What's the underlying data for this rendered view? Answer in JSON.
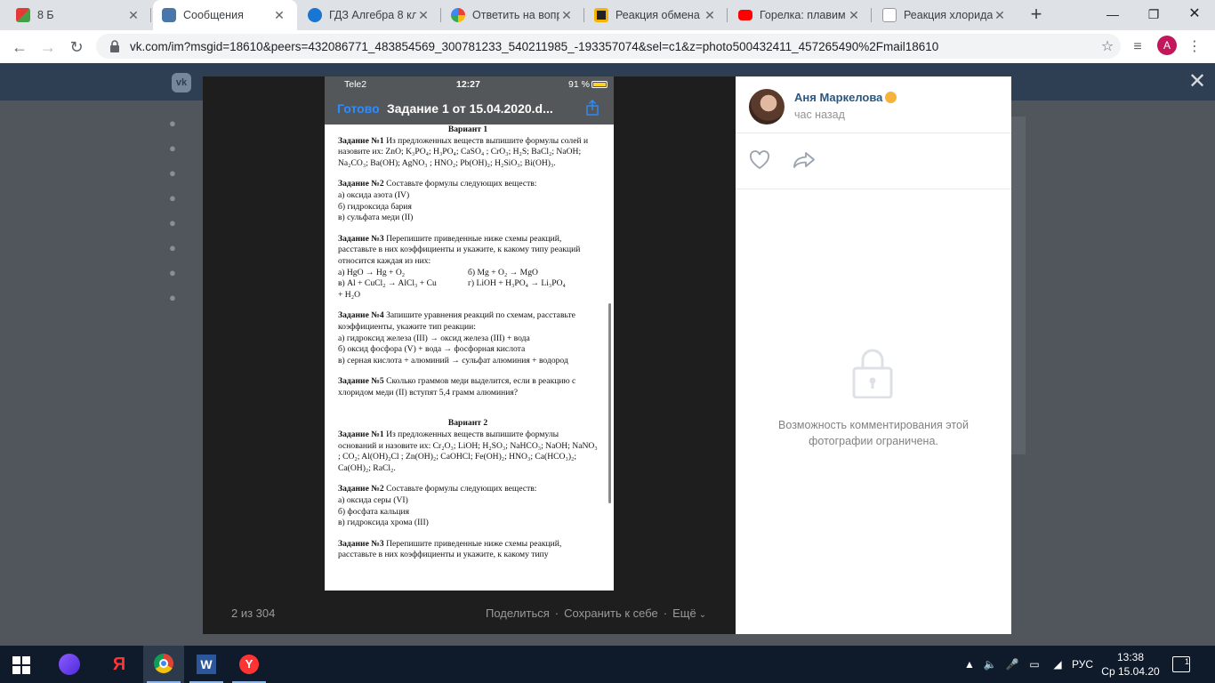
{
  "tabs": [
    {
      "title": "8 Б",
      "icon": "vk-colorful-icon"
    },
    {
      "title": "Сообщения",
      "icon": "vk-messages-icon"
    },
    {
      "title": "ГДЗ Алгебра 8 кл",
      "icon": "gdz-icon"
    },
    {
      "title": "Ответить на вопр",
      "icon": "google-icon"
    },
    {
      "title": "Реакция обмена",
      "icon": "o-icon"
    },
    {
      "title": "Горелка: плавим",
      "icon": "youtube-icon"
    },
    {
      "title": "Реакция хлорида",
      "icon": "doc-icon"
    }
  ],
  "address": {
    "url": "vk.com/im?msgid=18610&peers=432086771_483854569_300781233_540211985_-193357074&sel=c1&z=photo500432411_457265490%2Fmail18610"
  },
  "profile_initial": "A",
  "phone": {
    "carrier": "Tele2",
    "time": "12:27",
    "battery": "91 %",
    "done": "Готово",
    "doc_title": "Задание 1 от 15.04.2020.d..."
  },
  "doc": {
    "v1_head": "Вариант 1",
    "v1_t1_b": "Задание №1",
    "v1_t1": " Из предложенных веществ выпишите формулы солей и назовите их: ZnO; K₃PO₄; H₃PO₄; CaSO₄ ; CrO₃; H₂S; BaCl₂; NaOH; Na₂CO₃; Ba(OH); AgNO₃ ; HNO₂; Pb(OH)₂; H₂SiO₃; Bi(OH)₃.",
    "v1_t2_b": "Задание №2",
    "v1_t2": " Составьте формулы следующих веществ:",
    "v1_t2_a": "а) оксида азота (IV)",
    "v1_t2_bb": "б) гидроксида бария",
    "v1_t2_c": "в) сульфата меди (II)",
    "v1_t3_b": "Задание №3",
    "v1_t3": "  Перепишите приведенные ниже схемы реакций, расставьте в них коэффициенты и укажите, к какому типу реакций относится каждая из них:",
    "v1_t3_r1a": "а)  HgO → Hg + O₂",
    "v1_t3_r1b": "б) Mg + O₂ → MgO",
    "v1_t3_r2a": "в)  Al + CuCl₂ → AlCl₃ + Cu",
    "v1_t3_r2b": "г)  LiOH + H₃PO₄ → Li₃PO₄",
    "v1_t3_r3": "+ H₂O",
    "v1_t4_b": "Задание №4",
    "v1_t4": " Запишите уравнения реакций по схемам, расставьте коэффициенты, укажите тип реакции:",
    "v1_t4_a": "а) гидроксид железа (III) → оксид железа (III) + вода",
    "v1_t4_bb": "б) оксид фосфора (V) + вода → фосфорная кислота",
    "v1_t4_c": "в) серная кислота + алюминий → сульфат алюминия + водород",
    "v1_t5_b": "Задание №5",
    "v1_t5": " Сколько граммов меди выделится, если в реакцию с хлоридом меди (II) вступят 5,4 грамм алюминия?",
    "v2_head": "Вариант 2",
    "v2_t1_b": "Задание №1",
    "v2_t1": " Из предложенных веществ выпишите формулы оснований и назовите их: Cr₂O₃; LiOH; H₂SO₃; NaHCO₃; NaOH; NaNO₃ ; CO₂; Al(OH)₂Cl ; Zn(OH)₂; CaOHCl; Fe(OH)₂; HNO₃; Ca(HCO₃)₂; Ca(OH)₂; RaCl₂.",
    "v2_t2_b": "Задание №2",
    "v2_t2": " Составьте формулы следующих веществ:",
    "v2_t2_a": "а) оксида серы (VI)",
    "v2_t2_bb": "б) фосфата кальция",
    "v2_t2_c": "в) гидроксида хрома (III)",
    "v2_t3_b": "Задание №3",
    "v2_t3": " Перепишите приведенные ниже схемы реакций, расставьте в них коэффициенты и укажите, к какому типу"
  },
  "viewer": {
    "counter": "2 из 304",
    "share": "Поделиться",
    "save": "Сохранить к себе",
    "more": "Ещё"
  },
  "panel": {
    "author": "Аня Маркелова",
    "time": "час назад",
    "restricted": "Возможность комментирования этой фотографии ограничена."
  },
  "taskbar": {
    "lang": "РУС",
    "time": "13:38",
    "date": "Ср 15.04.20",
    "notifications": "1"
  },
  "colors": {
    "vk_link": "#2a5885",
    "ios_blue": "#2d8cff",
    "chrome_bg": "#dee1e6"
  }
}
